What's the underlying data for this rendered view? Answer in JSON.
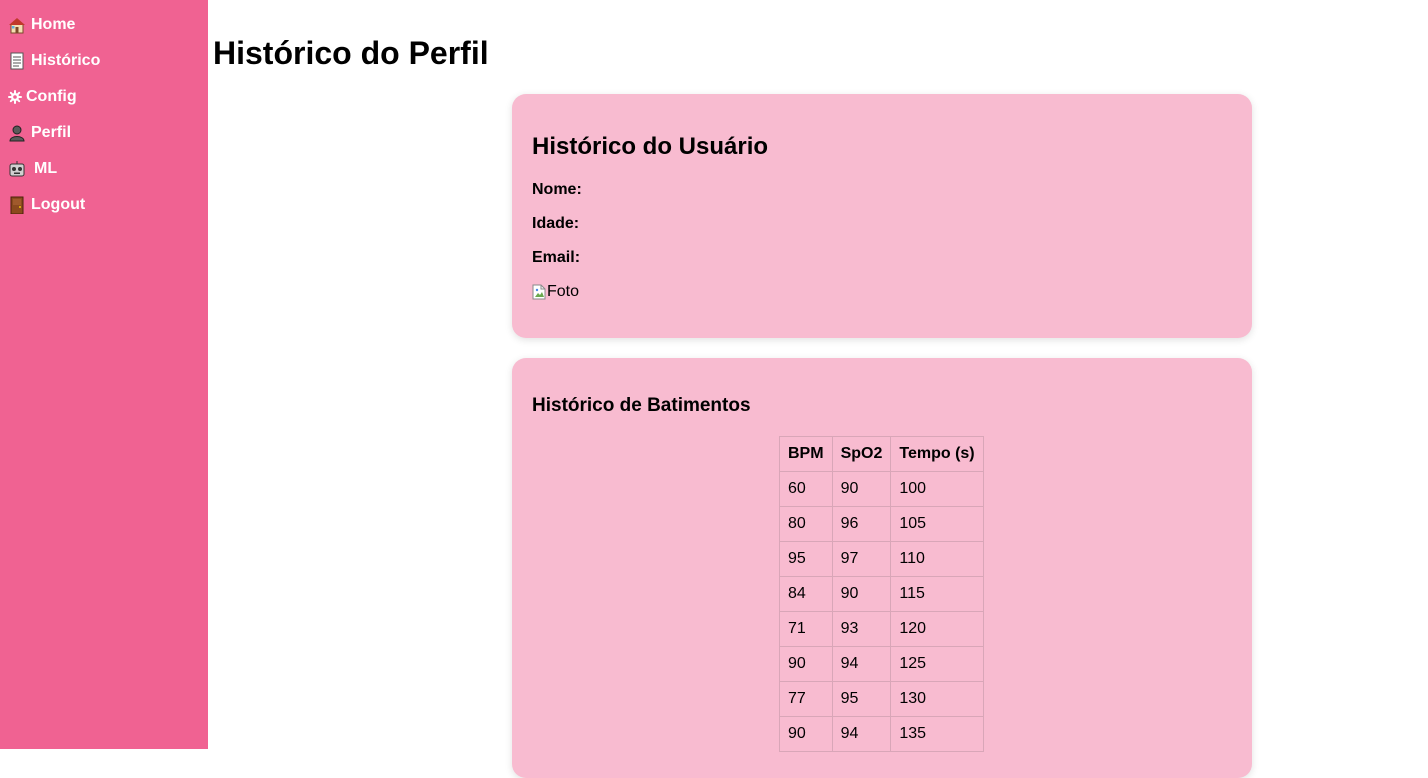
{
  "sidebar": {
    "items": [
      {
        "label": "Home",
        "icon": "house-icon"
      },
      {
        "label": "Histórico",
        "icon": "page-icon"
      },
      {
        "label": "Config",
        "icon": "gear-icon"
      },
      {
        "label": "Perfil",
        "icon": "person-icon"
      },
      {
        "label": "ML",
        "icon": "robot-icon"
      },
      {
        "label": "Logout",
        "icon": "door-icon"
      }
    ],
    "color": "#f06292"
  },
  "page": {
    "title": "Histórico do Perfil"
  },
  "user_card": {
    "title": "Histórico do Usuário",
    "name_label": "Nome:",
    "name_value": "",
    "age_label": "Idade:",
    "age_value": "",
    "email_label": "Email:",
    "email_value": "",
    "photo_alt": "Foto",
    "color": "#f8bbd0"
  },
  "beats_card": {
    "title": "Histórico de Batimentos",
    "headers": [
      "BPM",
      "SpO2",
      "Tempo (s)"
    ],
    "rows": [
      [
        "60",
        "90",
        "100"
      ],
      [
        "80",
        "96",
        "105"
      ],
      [
        "95",
        "97",
        "110"
      ],
      [
        "84",
        "90",
        "115"
      ],
      [
        "71",
        "93",
        "120"
      ],
      [
        "90",
        "94",
        "125"
      ],
      [
        "77",
        "95",
        "130"
      ],
      [
        "90",
        "94",
        "135"
      ]
    ]
  }
}
